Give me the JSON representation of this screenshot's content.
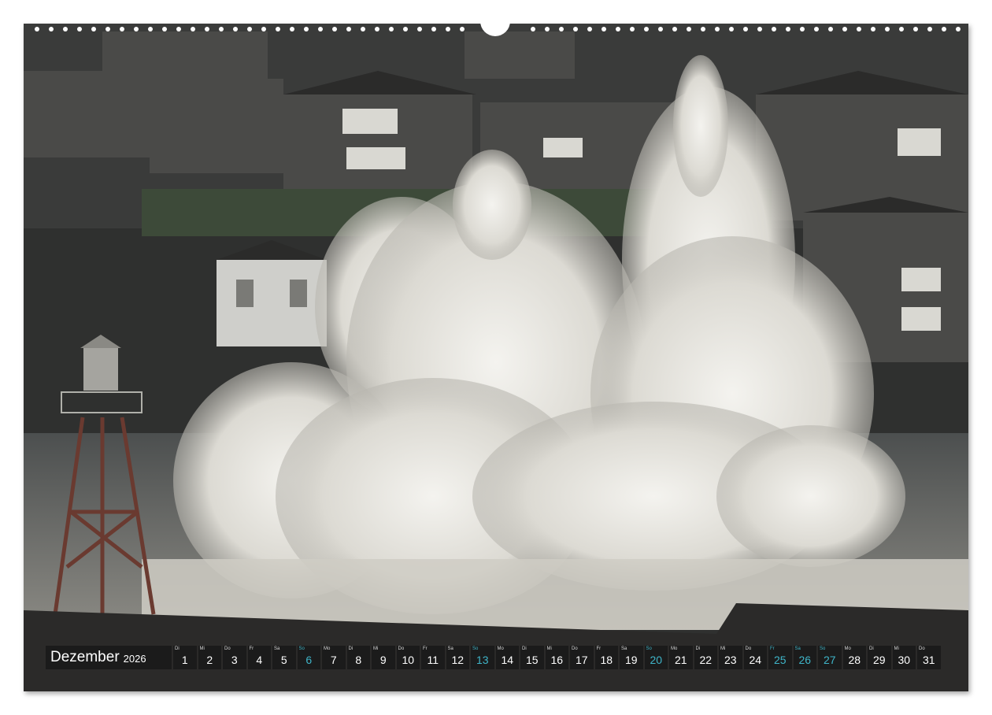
{
  "calendar": {
    "month": "Dezember",
    "year": "2026",
    "weekend_color": "#3fb5c9",
    "days": [
      {
        "abbr": "Di",
        "num": "1",
        "weekend": false
      },
      {
        "abbr": "Mi",
        "num": "2",
        "weekend": false
      },
      {
        "abbr": "Do",
        "num": "3",
        "weekend": false
      },
      {
        "abbr": "Fr",
        "num": "4",
        "weekend": false
      },
      {
        "abbr": "Sa",
        "num": "5",
        "weekend": false
      },
      {
        "abbr": "So",
        "num": "6",
        "weekend": true
      },
      {
        "abbr": "Mo",
        "num": "7",
        "weekend": false
      },
      {
        "abbr": "Di",
        "num": "8",
        "weekend": false
      },
      {
        "abbr": "Mi",
        "num": "9",
        "weekend": false
      },
      {
        "abbr": "Do",
        "num": "10",
        "weekend": false
      },
      {
        "abbr": "Fr",
        "num": "11",
        "weekend": false
      },
      {
        "abbr": "Sa",
        "num": "12",
        "weekend": false
      },
      {
        "abbr": "So",
        "num": "13",
        "weekend": true
      },
      {
        "abbr": "Mo",
        "num": "14",
        "weekend": false
      },
      {
        "abbr": "Di",
        "num": "15",
        "weekend": false
      },
      {
        "abbr": "Mi",
        "num": "16",
        "weekend": false
      },
      {
        "abbr": "Do",
        "num": "17",
        "weekend": false
      },
      {
        "abbr": "Fr",
        "num": "18",
        "weekend": false
      },
      {
        "abbr": "Sa",
        "num": "19",
        "weekend": false
      },
      {
        "abbr": "So",
        "num": "20",
        "weekend": true
      },
      {
        "abbr": "Mo",
        "num": "21",
        "weekend": false
      },
      {
        "abbr": "Di",
        "num": "22",
        "weekend": false
      },
      {
        "abbr": "Mi",
        "num": "23",
        "weekend": false
      },
      {
        "abbr": "Do",
        "num": "24",
        "weekend": false
      },
      {
        "abbr": "Fr",
        "num": "25",
        "weekend": true
      },
      {
        "abbr": "Sa",
        "num": "26",
        "weekend": true
      },
      {
        "abbr": "So",
        "num": "27",
        "weekend": true
      },
      {
        "abbr": "Mo",
        "num": "28",
        "weekend": false
      },
      {
        "abbr": "Di",
        "num": "29",
        "weekend": false
      },
      {
        "abbr": "Mi",
        "num": "30",
        "weekend": false
      },
      {
        "abbr": "Do",
        "num": "31",
        "weekend": false
      }
    ]
  },
  "photo": {
    "subject": "storm-wave-photo",
    "colors": {
      "sky": "#2e2f2e",
      "spray": "#ecebe6",
      "sea": "#5a5c5b",
      "wall": "#2a2a2a"
    }
  }
}
